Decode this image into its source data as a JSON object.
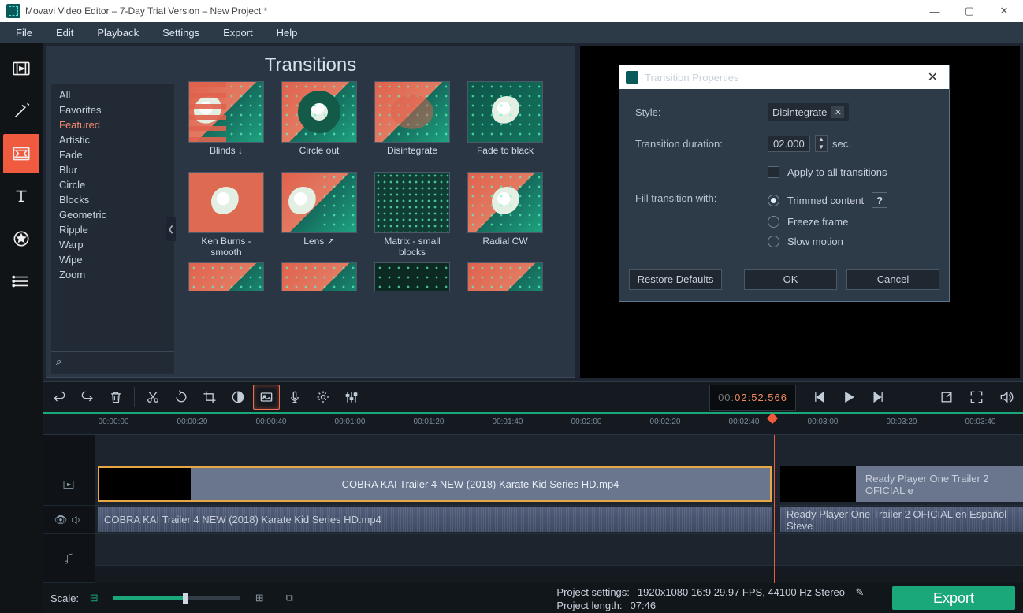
{
  "titlebar": {
    "title": "Movavi Video Editor – 7-Day Trial Version – New Project *"
  },
  "menu": [
    "File",
    "Edit",
    "Playback",
    "Settings",
    "Export",
    "Help"
  ],
  "transitions": {
    "heading": "Transitions",
    "categories": [
      "All",
      "Favorites",
      "Featured",
      "Artistic",
      "Fade",
      "Blur",
      "Circle",
      "Blocks",
      "Geometric",
      "Ripple",
      "Warp",
      "Wipe",
      "Zoom"
    ],
    "selected_category": "Featured",
    "items": [
      {
        "label": "Blinds ↓"
      },
      {
        "label": "Circle out"
      },
      {
        "label": "Disintegrate"
      },
      {
        "label": "Fade to black"
      },
      {
        "label": "Ken Burns - smooth"
      },
      {
        "label": "Lens ↗"
      },
      {
        "label": "Matrix - small blocks"
      },
      {
        "label": "Radial CW"
      }
    ],
    "search_placeholder": ""
  },
  "dialog": {
    "title": "Transition Properties",
    "style_label": "Style:",
    "style_value": "Disintegrate",
    "duration_label": "Transition duration:",
    "duration_value": "02.000",
    "duration_unit": "sec.",
    "apply_all": "Apply to all transitions",
    "fill_label": "Fill transition with:",
    "fill_options": [
      "Trimmed content",
      "Freeze frame",
      "Slow motion"
    ],
    "fill_selected": 0,
    "restore": "Restore Defaults",
    "ok": "OK",
    "cancel": "Cancel"
  },
  "timecode": {
    "h": "00:",
    "m": "02:52.566"
  },
  "ruler": [
    "00:00:00",
    "00:00:20",
    "00:00:40",
    "00:01:00",
    "00:01:20",
    "00:01:40",
    "00:02:00",
    "00:02:20",
    "00:02:40",
    "00:03:00",
    "00:03:20",
    "00:03:40"
  ],
  "clips": {
    "video1": "COBRA KAI Trailer 4 NEW (2018) Karate Kid Series HD.mp4",
    "video2": "Ready Player One   Trailer 2 OFICIAL e",
    "audio1": "COBRA KAI Trailer 4 NEW (2018) Karate Kid Series HD.mp4",
    "audio2": "Ready Player One   Trailer 2 OFICIAL en Español   Steve"
  },
  "status": {
    "scale": "Scale:",
    "project_settings_label": "Project settings:",
    "project_settings": "1920x1080 16:9 29.97 FPS, 44100 Hz Stereo",
    "project_length_label": "Project length:",
    "project_length": "07:46",
    "export": "Export"
  }
}
